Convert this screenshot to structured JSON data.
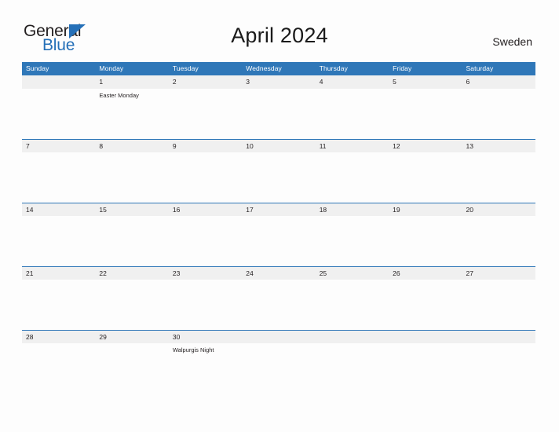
{
  "brand": {
    "logo_line1": "General",
    "logo_line2": "Blue",
    "accent_color": "#2570b8"
  },
  "header": {
    "title": "April 2024",
    "locale": "Sweden"
  },
  "theme": {
    "header_blue": "#2f77b8",
    "date_band_gray": "#f0f0f0",
    "page_background": "#fdfdfd",
    "text_dark": "#231f20"
  },
  "calendar": {
    "month": "April",
    "year": "2024",
    "weekday_headers": [
      "Sunday",
      "Monday",
      "Tuesday",
      "Wednesday",
      "Thursday",
      "Friday",
      "Saturday"
    ],
    "weeks": [
      {
        "days": [
          {
            "date": "",
            "event": ""
          },
          {
            "date": "1",
            "event": "Easter Monday"
          },
          {
            "date": "2",
            "event": ""
          },
          {
            "date": "3",
            "event": ""
          },
          {
            "date": "4",
            "event": ""
          },
          {
            "date": "5",
            "event": ""
          },
          {
            "date": "6",
            "event": ""
          }
        ]
      },
      {
        "days": [
          {
            "date": "7",
            "event": ""
          },
          {
            "date": "8",
            "event": ""
          },
          {
            "date": "9",
            "event": ""
          },
          {
            "date": "10",
            "event": ""
          },
          {
            "date": "11",
            "event": ""
          },
          {
            "date": "12",
            "event": ""
          },
          {
            "date": "13",
            "event": ""
          }
        ]
      },
      {
        "days": [
          {
            "date": "14",
            "event": ""
          },
          {
            "date": "15",
            "event": ""
          },
          {
            "date": "16",
            "event": ""
          },
          {
            "date": "17",
            "event": ""
          },
          {
            "date": "18",
            "event": ""
          },
          {
            "date": "19",
            "event": ""
          },
          {
            "date": "20",
            "event": ""
          }
        ]
      },
      {
        "days": [
          {
            "date": "21",
            "event": ""
          },
          {
            "date": "22",
            "event": ""
          },
          {
            "date": "23",
            "event": ""
          },
          {
            "date": "24",
            "event": ""
          },
          {
            "date": "25",
            "event": ""
          },
          {
            "date": "26",
            "event": ""
          },
          {
            "date": "27",
            "event": ""
          }
        ]
      },
      {
        "days": [
          {
            "date": "28",
            "event": ""
          },
          {
            "date": "29",
            "event": ""
          },
          {
            "date": "30",
            "event": "Walpurgis Night"
          },
          {
            "date": "",
            "event": ""
          },
          {
            "date": "",
            "event": ""
          },
          {
            "date": "",
            "event": ""
          },
          {
            "date": "",
            "event": ""
          }
        ]
      }
    ]
  }
}
